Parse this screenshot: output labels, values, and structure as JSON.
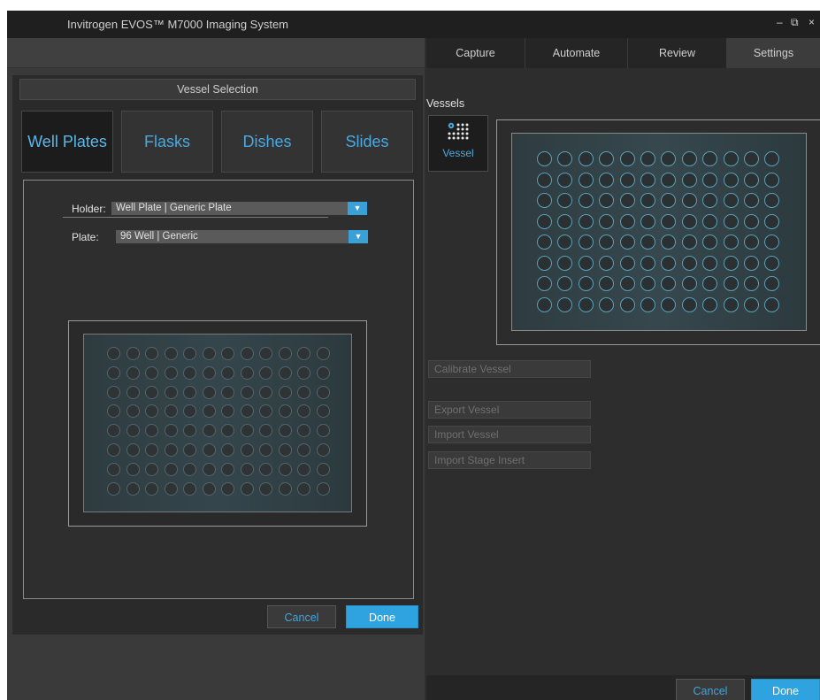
{
  "window": {
    "title": "Invitrogen EVOS™ M7000 Imaging System",
    "min_glyph": "–",
    "max_glyph": "⧉",
    "close_glyph": "×"
  },
  "tabs": [
    {
      "label": "Capture",
      "active": false
    },
    {
      "label": "Automate",
      "active": false
    },
    {
      "label": "Review",
      "active": false
    },
    {
      "label": "Settings",
      "active": true
    }
  ],
  "dialog": {
    "title": "Vessel Selection",
    "vessel_types": [
      {
        "label": "Well Plates",
        "active": true
      },
      {
        "label": "Flasks",
        "active": false
      },
      {
        "label": "Dishes",
        "active": false
      },
      {
        "label": "Slides",
        "active": false
      }
    ],
    "holder": {
      "label": "Holder:",
      "value": "Well Plate | Generic Plate",
      "dropdown_icon": "chevron-down-icon"
    },
    "plate": {
      "label": "Plate:",
      "value": "96 Well | Generic",
      "dropdown_icon": "chevron-down-icon"
    },
    "plate_layout": {
      "rows": 8,
      "cols": 12
    },
    "cancel_label": "Cancel",
    "done_label": "Done"
  },
  "settings": {
    "section_label": "Vessels",
    "vessel_tile_label": "Vessel",
    "vessel_tile_icon": "well-grid-gear-icon",
    "plate_layout": {
      "rows": 8,
      "cols": 12
    },
    "actions": [
      {
        "label": "Calibrate Vessel",
        "enabled": false
      },
      {
        "label": "Export Vessel",
        "enabled": false
      },
      {
        "label": "Import Vessel",
        "enabled": false
      },
      {
        "label": "Import Stage Insert",
        "enabled": false
      }
    ],
    "cancel_label": "Cancel",
    "done_label": "Done"
  },
  "colors": {
    "accent": "#2fa3e0",
    "accent_text": "#49a9e0",
    "background": "#2f2f2f",
    "titlebar": "#1f1f1f"
  }
}
